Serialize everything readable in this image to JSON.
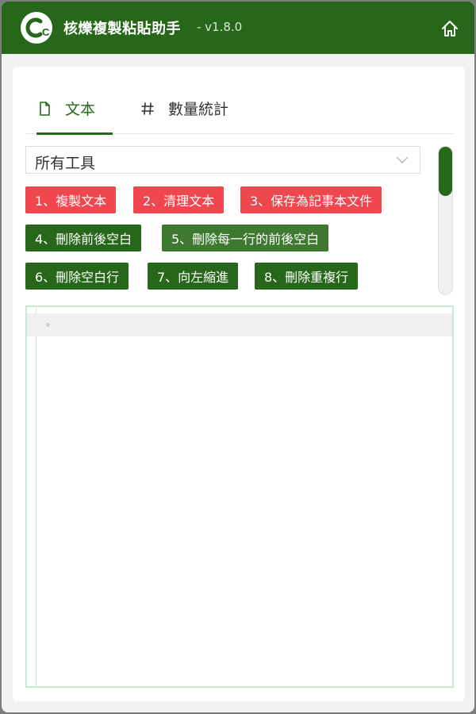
{
  "app": {
    "title": "核爍複製粘貼助手",
    "version": "- v1.8.0",
    "logo_text": "C"
  },
  "tabs": [
    {
      "label": "文本",
      "icon": "file-icon",
      "active": true
    },
    {
      "label": "數量統計",
      "icon": "hash-icon",
      "active": false
    }
  ],
  "tool_select": {
    "value": "所有工具"
  },
  "tools": [
    {
      "label": "1、複製文本",
      "color": "#f0464e"
    },
    {
      "label": "2、清理文本",
      "color": "#f0464e"
    },
    {
      "label": "3、保存為記事本文件",
      "color": "#f0464e"
    },
    {
      "label": "4、刪除前後空白",
      "color": "#27671a"
    },
    {
      "label": "5、刪除每一行的前後空白",
      "color": "#3d7a30"
    },
    {
      "label": "6、刪除空白行",
      "color": "#27671a"
    },
    {
      "label": "7、向左縮進",
      "color": "#27671a"
    },
    {
      "label": "8、刪除重複行",
      "color": "#27671a"
    }
  ],
  "colors": {
    "brand": "#27671a",
    "danger": "#f0464e",
    "editor_border": "#c6ebd0"
  },
  "editor": {
    "content": ""
  }
}
